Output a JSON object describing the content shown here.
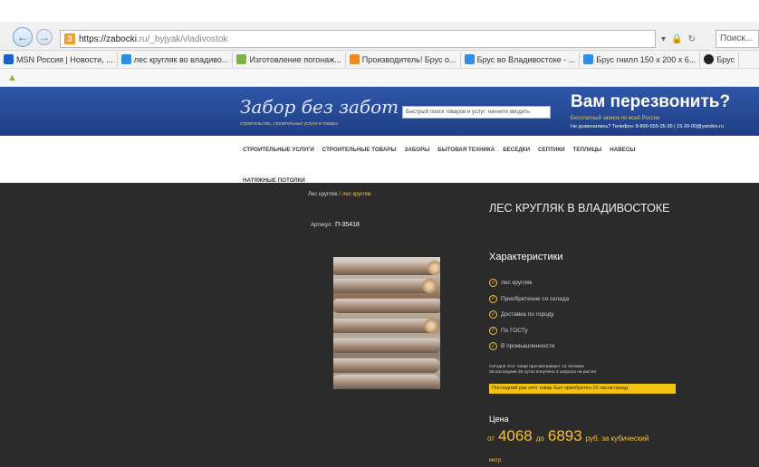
{
  "browser": {
    "url_host": "https://zabocki",
    "url_path": ".ru/_byjyak/vladivostok",
    "search_placeholder": "Поиск...",
    "favorites": [
      {
        "label": "MSN Россия | Новости, ...",
        "color": "#1b62c6"
      },
      {
        "label": "лес кругляк во владиво...",
        "color": "#2f8de4"
      },
      {
        "label": "Изготовление погонаж...",
        "color": "#7cb342"
      },
      {
        "label": "Производитель! Брус о...",
        "color": "#f08a24"
      },
      {
        "label": "Брус во Владивостоке - ...",
        "color": "#2f8de4"
      },
      {
        "label": "Брус гнилл 150 х 200 х 6...",
        "color": "#2f8de4"
      },
      {
        "label": "Брус",
        "color": "#222222"
      }
    ]
  },
  "site": {
    "logo": "Забор без забот",
    "logo_sub": "строительство, строительные услуги и товары",
    "search_placeholder": "Быстрый поиск товаров и услуг: начните вводить",
    "callback_title": "Вам перезвонить?",
    "callback_sub1": "Бесплатный звонок по всей России",
    "callback_sub2": "Не дозвонились? Телефон: 8-800-555-35-35 | 15-20-00@yandex.ru",
    "menu": [
      "СТРОИТЕЛЬНЫЕ УСЛУГИ",
      "СТРОИТЕЛЬНЫЕ ТОВАРЫ",
      "ЗАБОРЫ",
      "БЫТОВАЯ ТЕХНИКА",
      "БЕСЕДКИ",
      "СЕПТИКИ",
      "ТЕПЛИЦЫ",
      "НАВЕСЫ"
    ],
    "menu_row2": "НАТЯЖНЫЕ ПОТОЛКИ"
  },
  "product": {
    "breadcrumb_root": "Лес кругляк",
    "breadcrumb_sep": "/",
    "breadcrumb_current": "лес кругляк",
    "article_label": "Артикул:",
    "article_value": "П-35418",
    "title": "ЛЕС КРУГЛЯК В ВЛАДИВОСТОКЕ",
    "char_heading": "Характеристики",
    "characteristics": [
      "лес кругляк",
      "Приобретение со склада",
      "Доставка по городу",
      "По ГОСТу",
      "В промышленности"
    ],
    "note_line1": "Сегодня этот товар просматривают 12 человек",
    "note_line2": "За последние 30 суток получено 4 запроса на расчет",
    "promo": "Последний раз этот товар был приобретен 10 часов назад",
    "price_heading": "Цена",
    "price_from": "от",
    "price_min": "4068",
    "price_to": "до",
    "price_max": "6893",
    "price_unit": "руб. за кубический",
    "more": "метр"
  }
}
